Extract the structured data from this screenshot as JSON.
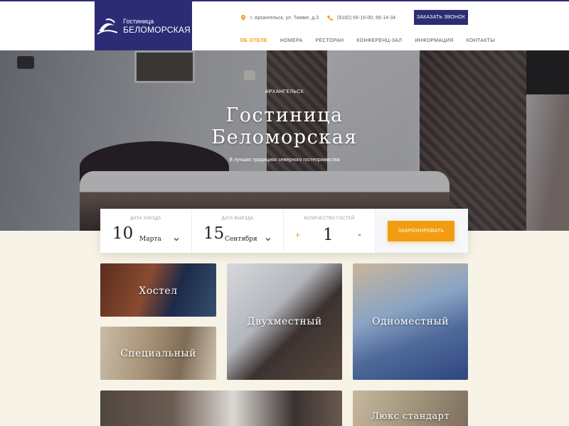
{
  "brand": {
    "name_small": "Гостиница",
    "name_big": "БЕЛОМОРСКАЯ"
  },
  "header": {
    "address": "г. Архангельск, ул. Тимме, д.3",
    "phone": "(8182) 66-16-00, 66-14-34",
    "callback_label": "Заказать звонок",
    "nav": [
      {
        "label": "Об отеле",
        "active": true
      },
      {
        "label": "Номера",
        "active": false
      },
      {
        "label": "Ресторан",
        "active": false
      },
      {
        "label": "Конференц-зал",
        "active": false
      },
      {
        "label": "Информация",
        "active": false
      },
      {
        "label": "Контакты",
        "active": false
      }
    ]
  },
  "hero": {
    "kicker": "Архангельск",
    "title_line1": "Гостиница",
    "title_line2": "Беломорская",
    "subtitle": "В лучших традициях северного гостеприимства"
  },
  "booking": {
    "arrival_label": "Дата заезда",
    "arrival_day": "10",
    "arrival_month": "Марта",
    "departure_label": "Дата выезда",
    "departure_day": "15",
    "departure_month": "Сентября",
    "guests_label": "Количество гостей",
    "guests_count": "1",
    "plus": "+",
    "minus": "-",
    "book_label": "Забронировать"
  },
  "rooms": [
    {
      "label": "Хостел"
    },
    {
      "label": "Специальный"
    },
    {
      "label": "Двухместный"
    },
    {
      "label": "Одноместный"
    },
    {
      "label": ""
    },
    {
      "label": "Люкс стандарт"
    }
  ],
  "colors": {
    "brand_navy": "#2b2c74",
    "accent_orange": "#f39c12",
    "page_bg": "#f7f3e6"
  }
}
